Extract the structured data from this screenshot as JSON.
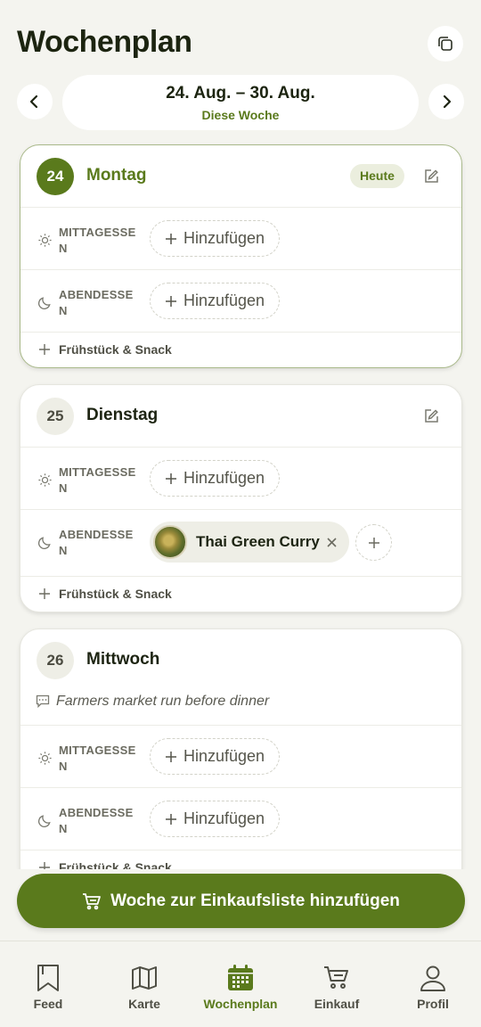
{
  "header": {
    "title": "Wochenplan",
    "copy_icon": "copy-icon"
  },
  "week": {
    "range": "24. Aug. – 30. Aug.",
    "subtitle": "Diese Woche"
  },
  "days": [
    {
      "num": "24",
      "name": "Montag",
      "badge": "Heute",
      "today": true,
      "meals": [
        {
          "label": "MITTAGESSEN",
          "action": "Hinzufügen",
          "icon": "sun-icon"
        },
        {
          "label": "ABENDESSEN",
          "action": "Hinzufügen",
          "icon": "moon-icon"
        }
      ],
      "snack": "Frühstück & Snack"
    },
    {
      "num": "25",
      "name": "Dienstag",
      "meals": [
        {
          "label": "MITTAGESSEN",
          "action": "Hinzufügen",
          "icon": "sun-icon"
        },
        {
          "label": "ABENDESSEN",
          "recipe": "Thai Green Curry",
          "icon": "moon-icon"
        }
      ],
      "snack": "Frühstück & Snack"
    },
    {
      "num": "26",
      "name": "Mittwoch",
      "note": "Farmers market run before dinner",
      "meals": [
        {
          "label": "MITTAGESSEN",
          "action": "Hinzufügen",
          "icon": "sun-icon"
        },
        {
          "label": "ABENDESSEN",
          "action": "Hinzufügen",
          "icon": "moon-icon"
        }
      ],
      "snack": "Frühstück & Snack"
    }
  ],
  "cta": {
    "label": "Woche zur Einkaufsliste hinzufügen",
    "icon": "cart-icon"
  },
  "nav": [
    {
      "label": "Feed",
      "icon": "bookmark-icon"
    },
    {
      "label": "Karte",
      "icon": "map-icon"
    },
    {
      "label": "Wochenplan",
      "icon": "calendar-icon",
      "active": true
    },
    {
      "label": "Einkauf",
      "icon": "cart-icon"
    },
    {
      "label": "Profil",
      "icon": "user-icon"
    }
  ],
  "colors": {
    "accent": "#5a7a1c",
    "background": "#f4f4ef",
    "card": "#ffffff"
  }
}
